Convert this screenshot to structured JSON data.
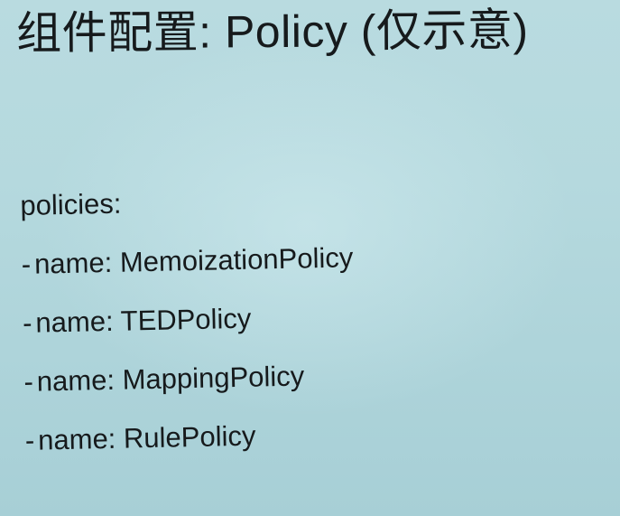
{
  "slide": {
    "title": "组件配置: Policy (仅示意)",
    "config_key": "policies:",
    "list_prefix": "- ",
    "item_key": "name:",
    "items": [
      "MemoizationPolicy",
      "TEDPolicy",
      "MappingPolicy",
      "RulePolicy"
    ]
  }
}
